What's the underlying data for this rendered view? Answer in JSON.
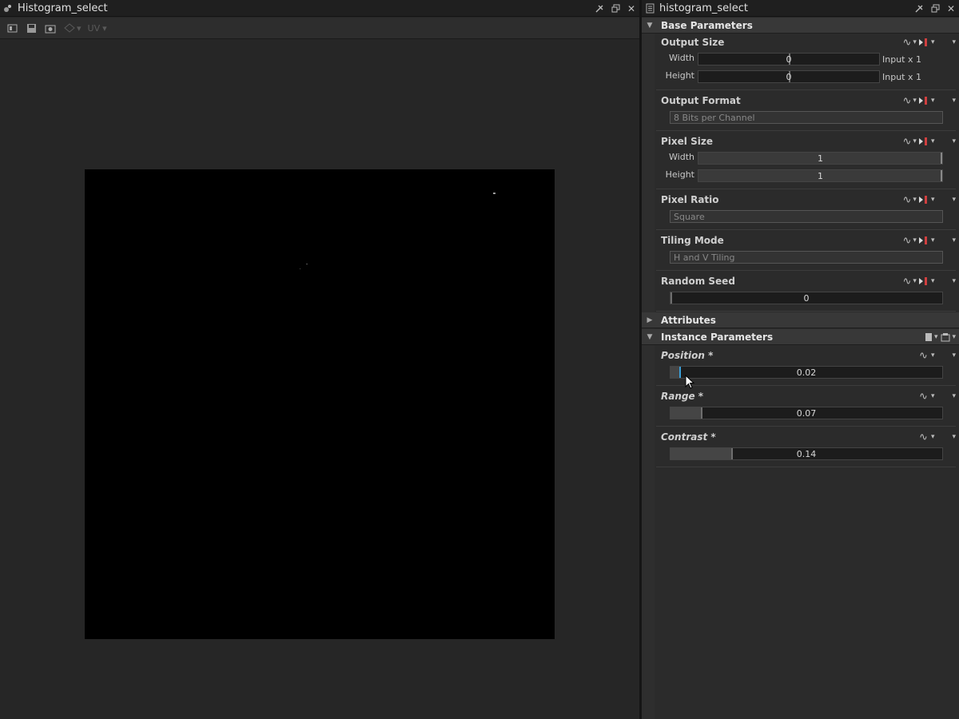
{
  "viewer": {
    "title": "Histogram_select",
    "toolbar": {
      "uv_label": "UV"
    }
  },
  "params": {
    "title": "histogram_select",
    "base_section": "Base Parameters",
    "output_size": {
      "title": "Output Size",
      "width_label": "Width",
      "width_value": "0",
      "width_suffix": "Input x 1",
      "height_label": "Height",
      "height_value": "0",
      "height_suffix": "Input x 1"
    },
    "output_format": {
      "title": "Output Format",
      "value": "8 Bits per Channel"
    },
    "pixel_size": {
      "title": "Pixel Size",
      "width_label": "Width",
      "width_value": "1",
      "height_label": "Height",
      "height_value": "1"
    },
    "pixel_ratio": {
      "title": "Pixel Ratio",
      "value": "Square"
    },
    "tiling_mode": {
      "title": "Tiling Mode",
      "value": "H and V Tiling"
    },
    "random_seed": {
      "title": "Random Seed",
      "value": "0"
    },
    "attributes_section": "Attributes",
    "instance_section": "Instance Parameters",
    "position": {
      "title": "Position *",
      "value": "0.02",
      "level": 0.02
    },
    "range": {
      "title": "Range *",
      "value": "0.07",
      "level": 0.07
    },
    "contrast": {
      "title": "Contrast *",
      "value": "0.14",
      "level": 0.14
    }
  },
  "colors": {
    "accent": "#3b9fd8",
    "link_icon": "#d04040"
  }
}
